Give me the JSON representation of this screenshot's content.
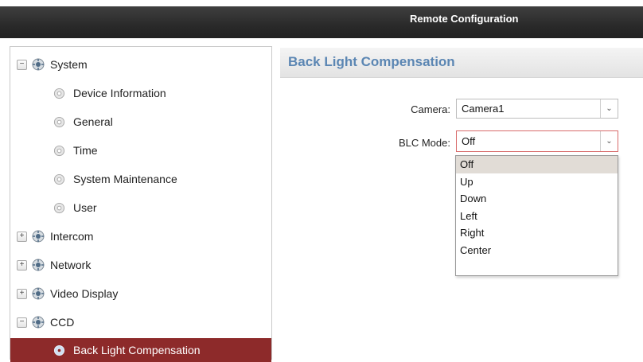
{
  "window": {
    "title": "Remote Configuration"
  },
  "sidebar": {
    "items": [
      {
        "label": "System",
        "toggle": "−",
        "kind": "group"
      },
      {
        "label": "Device Information",
        "kind": "leaf"
      },
      {
        "label": "General",
        "kind": "leaf"
      },
      {
        "label": "Time",
        "kind": "leaf"
      },
      {
        "label": "System Maintenance",
        "kind": "leaf"
      },
      {
        "label": "User",
        "kind": "leaf"
      },
      {
        "label": "Intercom",
        "toggle": "+",
        "kind": "group"
      },
      {
        "label": "Network",
        "toggle": "+",
        "kind": "group"
      },
      {
        "label": "Video Display",
        "toggle": "+",
        "kind": "group"
      },
      {
        "label": "CCD",
        "toggle": "−",
        "kind": "group"
      },
      {
        "label": "Back Light Compensation",
        "kind": "leaf",
        "selected": true
      }
    ]
  },
  "main": {
    "section_title": "Back Light Compensation",
    "camera": {
      "label": "Camera:",
      "value": "Camera1"
    },
    "blc_mode": {
      "label": "BLC Mode:",
      "value": "Off",
      "options": [
        "Off",
        "Up",
        "Down",
        "Left",
        "Right",
        "Center"
      ],
      "highlighted": "Off"
    }
  },
  "colors": {
    "selected_bg": "#8d2a2a",
    "header_text": "#5b86b3",
    "focus_border": "#d86b6b"
  }
}
